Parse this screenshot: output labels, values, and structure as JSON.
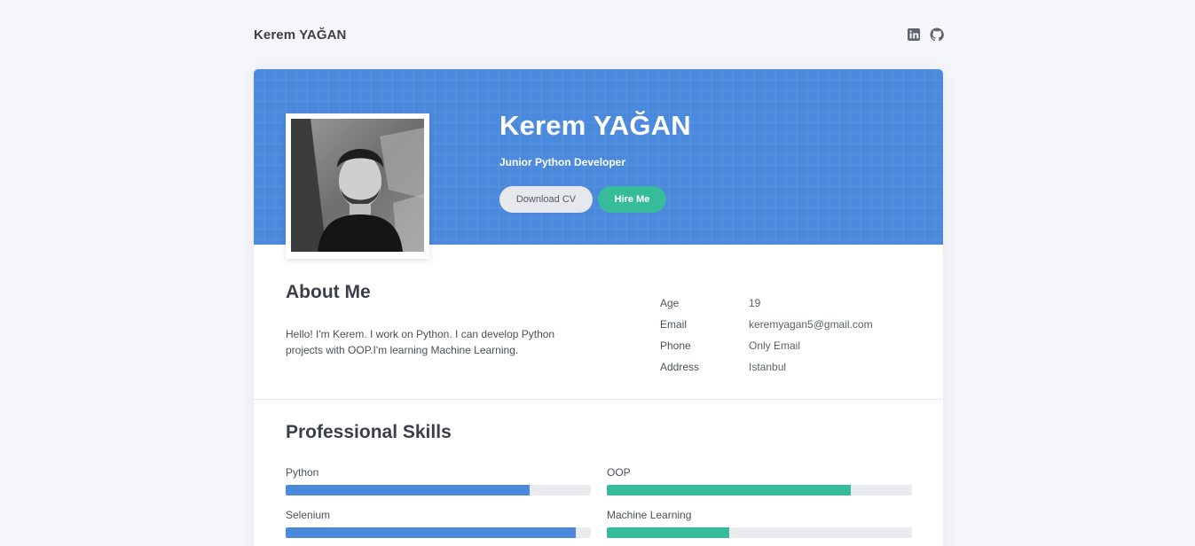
{
  "topbar": {
    "brand": "Kerem YAĞAN",
    "icons": [
      "linkedin-icon",
      "github-icon"
    ]
  },
  "hero": {
    "name": "Kerem YAĞAN",
    "title": "Junior Python Developer",
    "download_label": "Download CV",
    "hire_label": "Hire Me"
  },
  "about": {
    "heading": "About Me",
    "text": "Hello! I'm Kerem. I work on Python. I can develop Python projects with OOP.I'm learning Machine Learning.",
    "info": [
      {
        "key": "Age",
        "value": "19"
      },
      {
        "key": "Email",
        "value": "keremyagan5@gmail.com"
      },
      {
        "key": "Phone",
        "value": "Only Email"
      },
      {
        "key": "Address",
        "value": "Istanbul"
      }
    ]
  },
  "skills": {
    "heading": "Professional Skills",
    "items": [
      {
        "label": "Python",
        "level": 80,
        "color": "#4a89dc"
      },
      {
        "label": "OOP",
        "level": 80,
        "color": "#37bc9b"
      },
      {
        "label": "Selenium",
        "level": 95,
        "color": "#4a89dc"
      },
      {
        "label": "Machine Learning",
        "level": 40,
        "color": "#37bc9b"
      }
    ]
  },
  "colors": {
    "primary": "#4a89dc",
    "accent": "#37bc9b",
    "background": "#f5f6fa"
  }
}
